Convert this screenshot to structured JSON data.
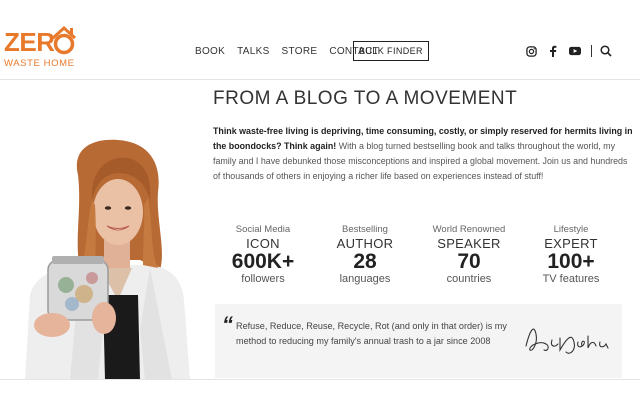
{
  "brand": {
    "logo_word": "ZER",
    "logo_sub": "WASTE HOME",
    "color": "#e8792b"
  },
  "nav": {
    "items": [
      "BOOK",
      "TALKS",
      "STORE",
      "CONTACT"
    ],
    "bulk_finder": "BULK FINDER"
  },
  "social": {
    "icons": [
      "instagram-icon",
      "facebook-icon",
      "youtube-icon",
      "search-icon"
    ]
  },
  "main": {
    "title": "FROM A BLOG TO A MOVEMENT",
    "intro_bold": "Think waste-free living is depriving, time consuming, costly, or simply reserved for hermits living in the boondocks? Think again!",
    "intro_rest": " With a blog turned bestselling book and talks throughout the world, my family and I have debunked those misconceptions and inspired a global movement. Join us and hundreds of thousands of others in enjoying a richer life based on experiences instead of stuff!"
  },
  "stats": [
    {
      "label": "Social Media",
      "role": "ICON",
      "number": "600K+",
      "sub": "followers"
    },
    {
      "label": "Bestselling",
      "role": "AUTHOR",
      "number": "28",
      "sub": "languages"
    },
    {
      "label": "World Renowned",
      "role": "SPEAKER",
      "number": "70",
      "sub": "countries"
    },
    {
      "label": "Lifestyle",
      "role": "EXPERT",
      "number": "100+",
      "sub": "TV features"
    }
  ],
  "quote": {
    "text": "Refuse, Reduce, Reuse, Recycle, Rot (and only in that order) is my method to reducing my family's annual trash to a jar since 2008",
    "signature": "Béa Johnson"
  }
}
